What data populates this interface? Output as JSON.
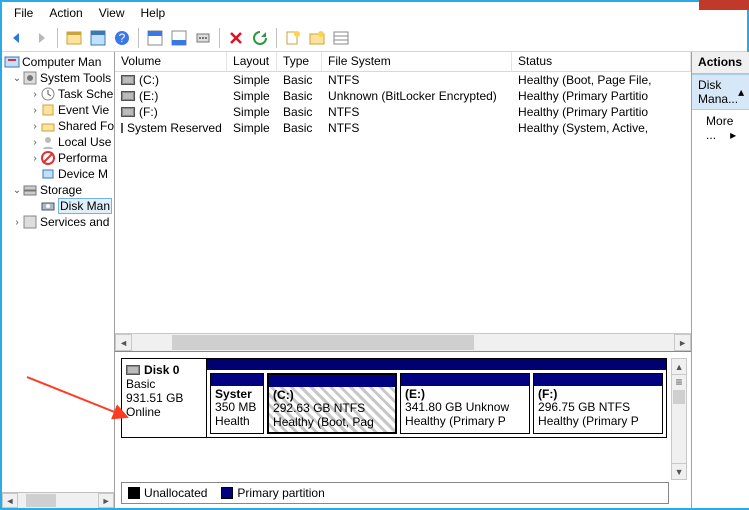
{
  "menu": {
    "file": "File",
    "action": "Action",
    "view": "View",
    "help": "Help"
  },
  "tree": {
    "root": "Computer Man",
    "systools": "System Tools",
    "task": "Task Sche",
    "event": "Event Vie",
    "shared": "Shared Fo",
    "local": "Local Use",
    "perf": "Performa",
    "device": "Device M",
    "storage": "Storage",
    "diskman": "Disk Man",
    "services": "Services and"
  },
  "cols": {
    "volume": "Volume",
    "layout": "Layout",
    "type": "Type",
    "fs": "File System",
    "status": "Status"
  },
  "rows": [
    {
      "v": "(C:)",
      "l": "Simple",
      "t": "Basic",
      "f": "NTFS",
      "s": "Healthy (Boot, Page File,"
    },
    {
      "v": "(E:)",
      "l": "Simple",
      "t": "Basic",
      "f": "Unknown (BitLocker Encrypted)",
      "s": "Healthy (Primary Partitio"
    },
    {
      "v": "(F:)",
      "l": "Simple",
      "t": "Basic",
      "f": "NTFS",
      "s": "Healthy (Primary Partitio"
    },
    {
      "v": "System Reserved",
      "l": "Simple",
      "t": "Basic",
      "f": "NTFS",
      "s": "Healthy (System, Active,"
    }
  ],
  "disk": {
    "name": "Disk 0",
    "kind": "Basic",
    "size": "931.51 GB",
    "state": "Online",
    "parts": [
      {
        "title": "Syster",
        "line2": "350 MB",
        "line3": "Health",
        "w": 54
      },
      {
        "title": "(C:)",
        "line2": "292.63 GB NTFS",
        "line3": "Healthy (Boot, Pag",
        "w": 130,
        "sel": true
      },
      {
        "title": "(E:)",
        "line2": "341.80 GB Unknow",
        "line3": "Healthy (Primary P",
        "w": 130
      },
      {
        "title": "(F:)",
        "line2": "296.75 GB NTFS",
        "line3": "Healthy (Primary P",
        "w": 130
      }
    ]
  },
  "legend": {
    "un": "Unallocated",
    "pr": "Primary partition"
  },
  "actions": {
    "hdr": "Actions",
    "sel": "Disk Mana...",
    "more": "More ..."
  }
}
